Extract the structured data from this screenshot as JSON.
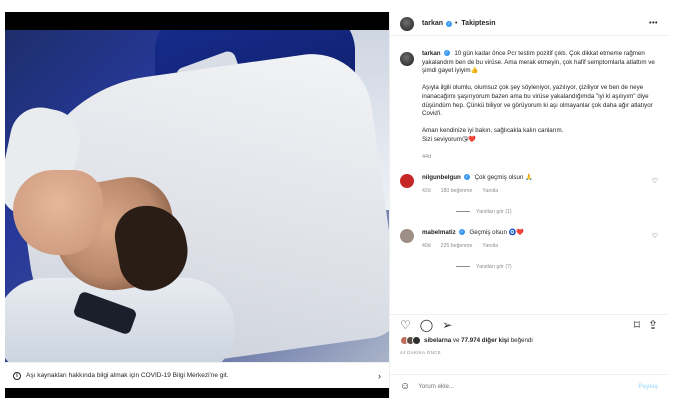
{
  "post": {
    "username": "tarkan",
    "follow_label": "Takiptesin",
    "more_icon": "more-horizontal-icon",
    "caption_paragraphs": [
      "10 gün kadar önce Pcr testim pozitif çıktı. Çok dikkat etmeme rağmen yakalandım ben de bu virüse. Ama merak etmeyin, çok hafif semptomlarla atlattım ve şimdi gayet iyiyim👍",
      "Aşıyla ilgili olumlu, olumsuz çok şey söyleniyor, yazılıyor, çiziliyor ve ben de neye inanacağımı şaşırıyorum bazen ama bu virüse yakalandığımda \"iyi ki aşılıyım\" diye düşündüm hep. Çünkü biliyor ve görüyorum ki aşı olmayanlar çok daha ağır atlatıyor Covid'i.",
      "Aman kendinize iyi bakın, sağlıcakla kalın canlarım.\nSizi seviyorum😘❤️"
    ],
    "caption_time": "44d"
  },
  "media_banner": {
    "text": "Aşı kaynakları hakkında bilgi almak için COVID-19 Bilgi Merkezi'ne git.",
    "info_icon": "info-icon",
    "chevron_icon": "chevron-right-icon"
  },
  "comments": [
    {
      "username": "nilgunbelgun",
      "text": "Çok geçmiş olsun 🙏",
      "time": "42d",
      "likes": "180 beğenme",
      "reply": "Yanıtla",
      "replies_label": "Yanıtları gör (1)",
      "avatar_color": "#c62828"
    },
    {
      "username": "mabelmatiz",
      "text": "Geçmiş olsun 🧿❤️",
      "time": "40d",
      "likes": "225 beğenme",
      "reply": "Yanıtla",
      "replies_label": "Yanıtları gör (7)",
      "avatar_color": "#9e8f86"
    }
  ],
  "actions": {
    "like_icon": "heart-icon",
    "comment_icon": "comment-icon",
    "share_icon": "send-icon",
    "save_icon": "bookmark-icon",
    "share2_icon": "share-icon"
  },
  "likes": {
    "text_user": "sibelarna",
    "text_middle": " ve ",
    "text_count": "77.974 diğer kişi",
    "text_end": " beğendi"
  },
  "timestamp": "44 DAKİKA ÖNCE",
  "add_comment": {
    "placeholder": "Yorum ekle...",
    "post_label": "Paylaş",
    "emoji_icon": "smiley-icon"
  },
  "colors": {
    "verified": "#3897f0",
    "heart_red": "#ed4956",
    "muted": "#8e8e8e",
    "post_disabled": "#b2dffc"
  }
}
